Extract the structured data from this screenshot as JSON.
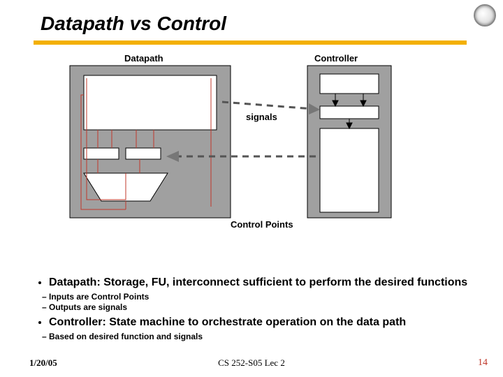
{
  "slide": {
    "title": "Datapath vs Control"
  },
  "diagram": {
    "datapath_label": "Datapath",
    "controller_label": "Controller",
    "signals_label": "signals",
    "control_points_label": "Control Points"
  },
  "bullets": {
    "b1": "Datapath: Storage, FU, interconnect sufficient to perform the desired functions",
    "b1a": "Inputs are Control Points",
    "b1b": "Outputs are signals",
    "b2": "Controller: State machine to orchestrate operation on the data path",
    "b2a": "Based on desired function and signals"
  },
  "footer": {
    "date": "1/20/05",
    "center": "CS 252-S05 Lec 2",
    "page": "14"
  }
}
